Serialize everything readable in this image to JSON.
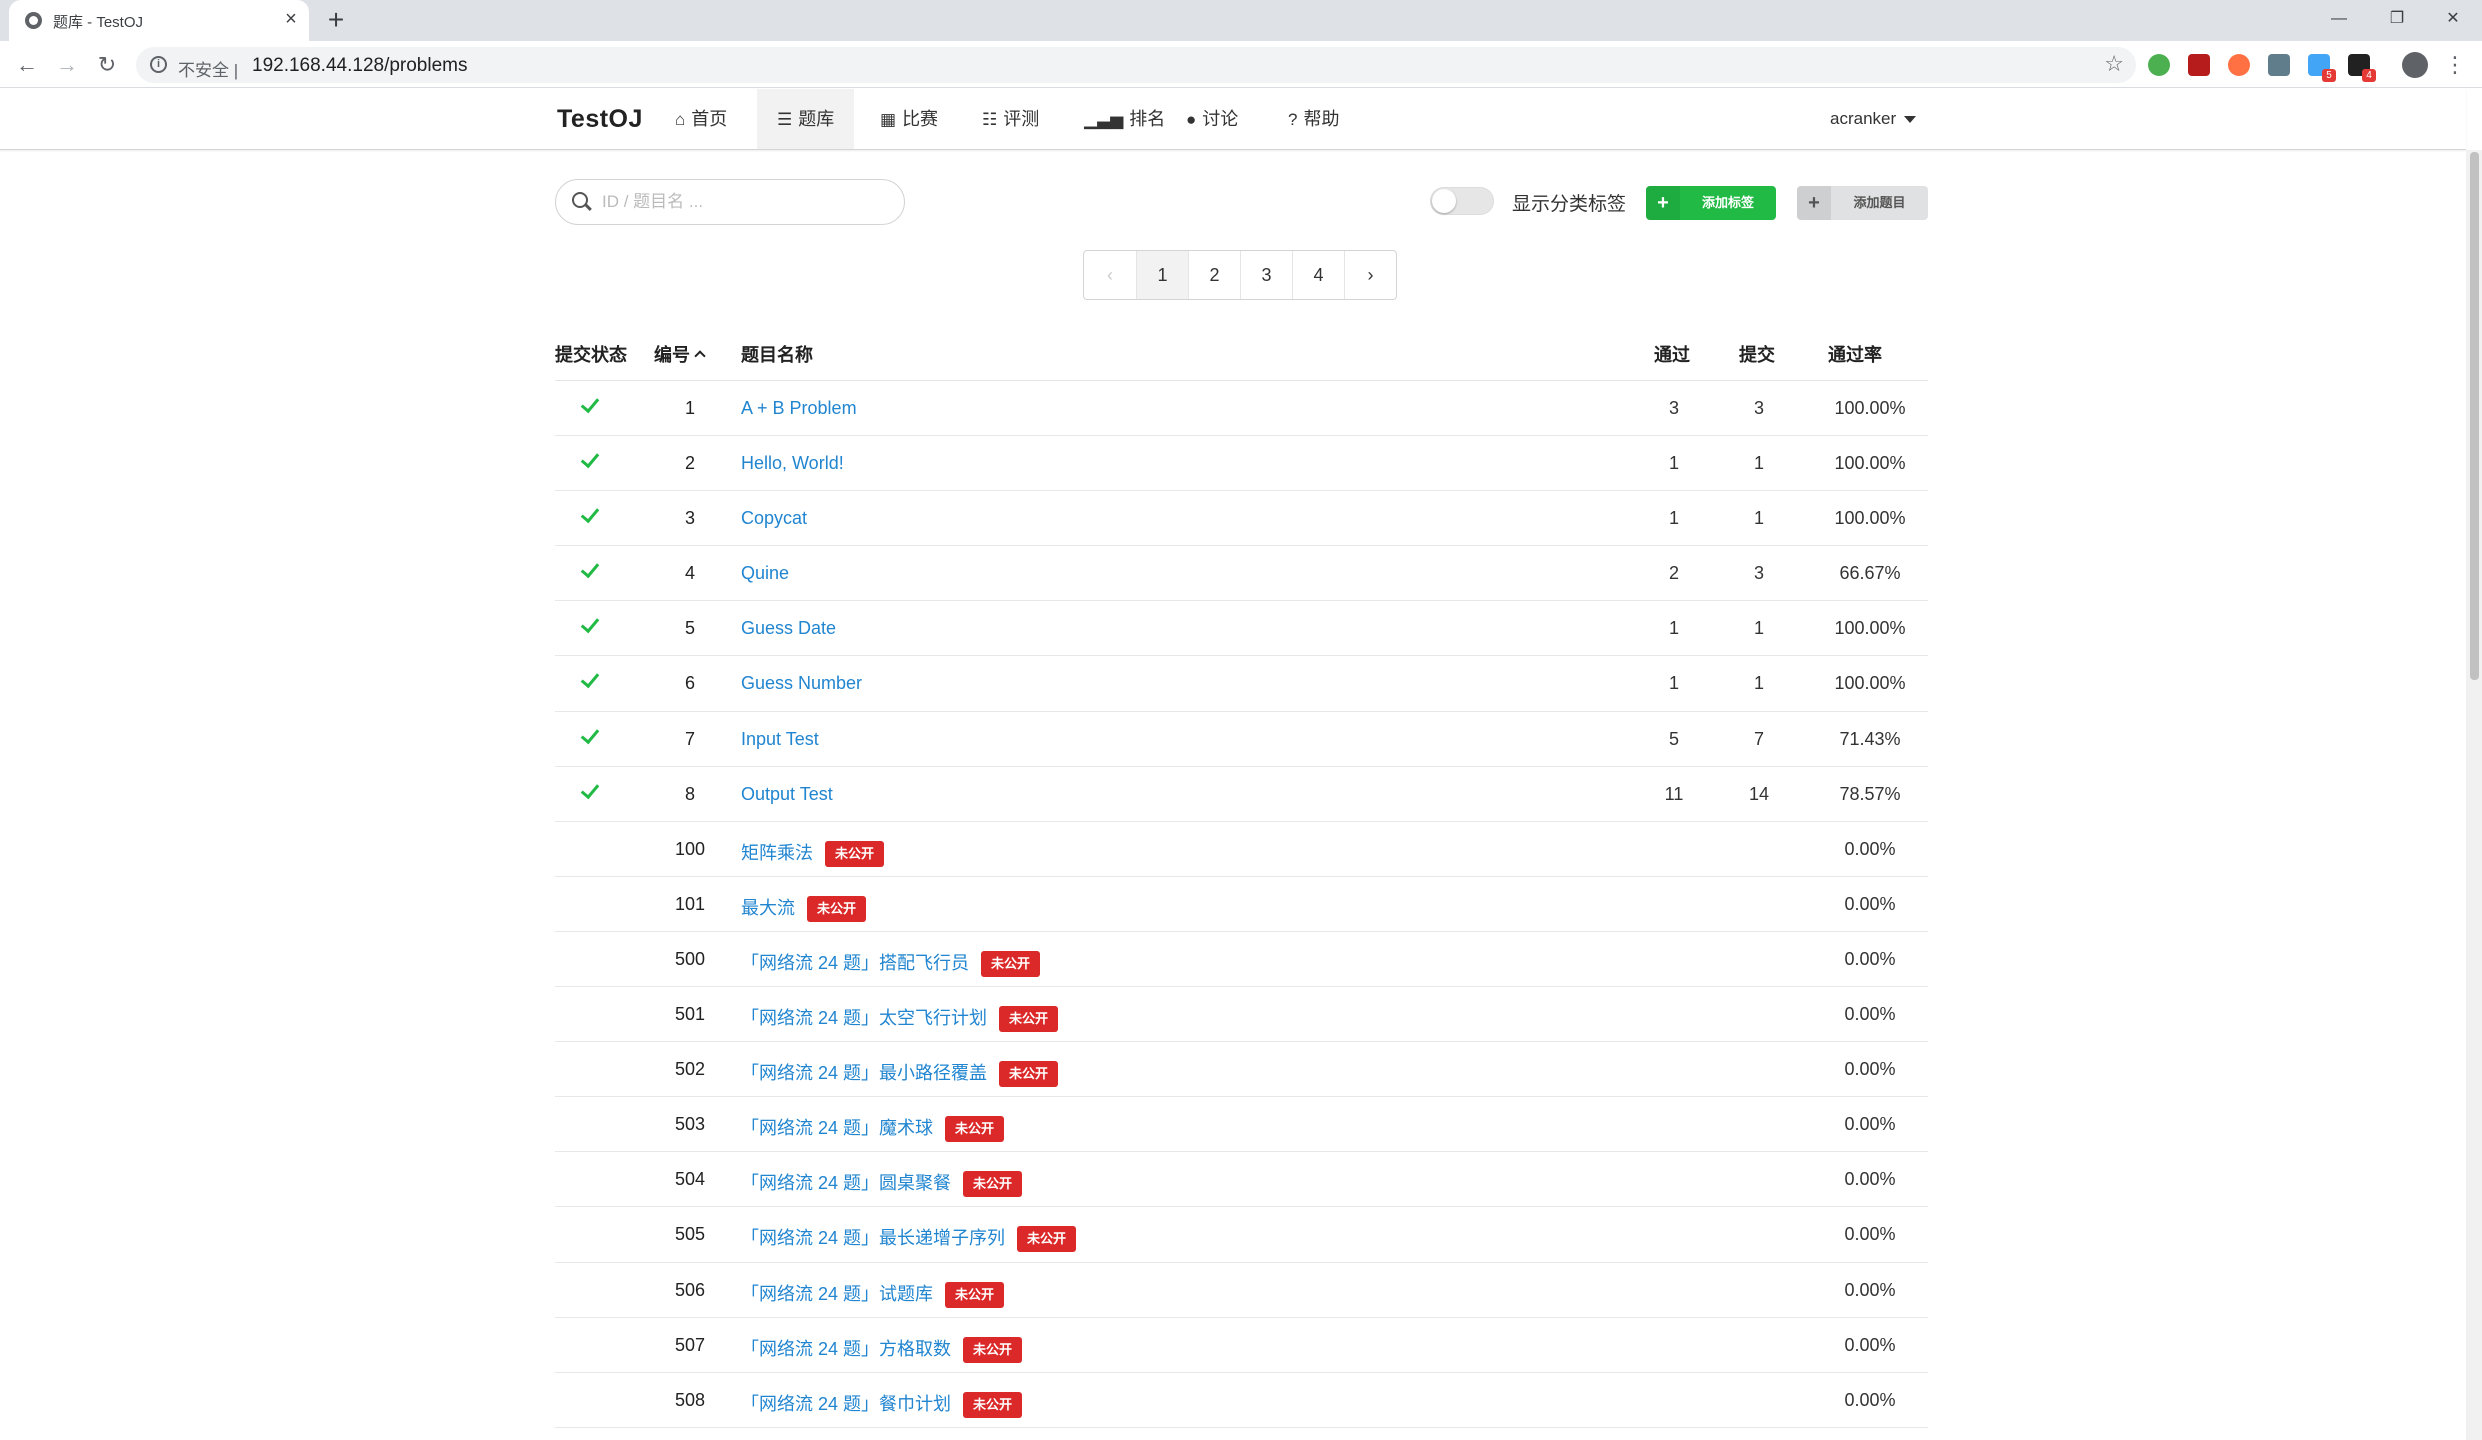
{
  "browser": {
    "tab_title": "题库 - TestOJ",
    "insecure_label": "不安全 |",
    "url": "192.168.44.128/problems",
    "extension_badges": [
      "5",
      "4"
    ]
  },
  "header": {
    "brand": "TestOJ",
    "menu": [
      {
        "label": "首页",
        "icon": "home-icon"
      },
      {
        "label": "题库",
        "icon": "list-icon",
        "active": true
      },
      {
        "label": "比赛",
        "icon": "calendar-icon"
      },
      {
        "label": "评测",
        "icon": "tasks-icon"
      },
      {
        "label": "排名",
        "icon": "signal-icon"
      },
      {
        "label": "讨论",
        "icon": "comments-icon"
      },
      {
        "label": "帮助",
        "icon": "question-icon"
      }
    ],
    "user": "acranker"
  },
  "controls": {
    "search_placeholder": "ID / 题目名 ...",
    "toggle_label": "显示分类标签",
    "toggle_on": false,
    "add_tag_label": "添加标签",
    "add_problem_label": "添加题目"
  },
  "pagination": {
    "pages": [
      "1",
      "2",
      "3",
      "4"
    ],
    "current": "1"
  },
  "table": {
    "headers": {
      "status": "提交状态",
      "id": "编号",
      "title": "题目名称",
      "accepted": "通过",
      "submitted": "提交",
      "rate": "通过率"
    },
    "badge_text": "未公开",
    "rows": [
      {
        "solved": true,
        "id": "1",
        "title": "A + B Problem",
        "accepted": "3",
        "submitted": "3",
        "rate": "100.00%",
        "hidden": false
      },
      {
        "solved": true,
        "id": "2",
        "title": "Hello, World!",
        "accepted": "1",
        "submitted": "1",
        "rate": "100.00%",
        "hidden": false
      },
      {
        "solved": true,
        "id": "3",
        "title": "Copycat",
        "accepted": "1",
        "submitted": "1",
        "rate": "100.00%",
        "hidden": false
      },
      {
        "solved": true,
        "id": "4",
        "title": "Quine",
        "accepted": "2",
        "submitted": "3",
        "rate": "66.67%",
        "hidden": false
      },
      {
        "solved": true,
        "id": "5",
        "title": "Guess Date",
        "accepted": "1",
        "submitted": "1",
        "rate": "100.00%",
        "hidden": false
      },
      {
        "solved": true,
        "id": "6",
        "title": "Guess Number",
        "accepted": "1",
        "submitted": "1",
        "rate": "100.00%",
        "hidden": false
      },
      {
        "solved": true,
        "id": "7",
        "title": "Input Test",
        "accepted": "5",
        "submitted": "7",
        "rate": "71.43%",
        "hidden": false
      },
      {
        "solved": true,
        "id": "8",
        "title": "Output Test",
        "accepted": "11",
        "submitted": "14",
        "rate": "78.57%",
        "hidden": false
      },
      {
        "solved": false,
        "id": "100",
        "title": "矩阵乘法",
        "accepted": "",
        "submitted": "",
        "rate": "0.00%",
        "hidden": true
      },
      {
        "solved": false,
        "id": "101",
        "title": "最大流",
        "accepted": "",
        "submitted": "",
        "rate": "0.00%",
        "hidden": true
      },
      {
        "solved": false,
        "id": "500",
        "title": "「网络流 24 题」搭配飞行员",
        "accepted": "",
        "submitted": "",
        "rate": "0.00%",
        "hidden": true
      },
      {
        "solved": false,
        "id": "501",
        "title": "「网络流 24 题」太空飞行计划",
        "accepted": "",
        "submitted": "",
        "rate": "0.00%",
        "hidden": true
      },
      {
        "solved": false,
        "id": "502",
        "title": "「网络流 24 题」最小路径覆盖",
        "accepted": "",
        "submitted": "",
        "rate": "0.00%",
        "hidden": true
      },
      {
        "solved": false,
        "id": "503",
        "title": "「网络流 24 题」魔术球",
        "accepted": "",
        "submitted": "",
        "rate": "0.00%",
        "hidden": true
      },
      {
        "solved": false,
        "id": "504",
        "title": "「网络流 24 题」圆桌聚餐",
        "accepted": "",
        "submitted": "",
        "rate": "0.00%",
        "hidden": true
      },
      {
        "solved": false,
        "id": "505",
        "title": "「网络流 24 题」最长递增子序列",
        "accepted": "",
        "submitted": "",
        "rate": "0.00%",
        "hidden": true
      },
      {
        "solved": false,
        "id": "506",
        "title": "「网络流 24 题」试题库",
        "accepted": "",
        "submitted": "",
        "rate": "0.00%",
        "hidden": true
      },
      {
        "solved": false,
        "id": "507",
        "title": "「网络流 24 题」方格取数",
        "accepted": "",
        "submitted": "",
        "rate": "0.00%",
        "hidden": true
      },
      {
        "solved": false,
        "id": "508",
        "title": "「网络流 24 题」餐巾计划",
        "accepted": "",
        "submitted": "",
        "rate": "0.00%",
        "hidden": true
      }
    ]
  },
  "colors": {
    "accent_green": "#21ba45",
    "link_blue": "#2185d0",
    "badge_red": "#db2828"
  }
}
